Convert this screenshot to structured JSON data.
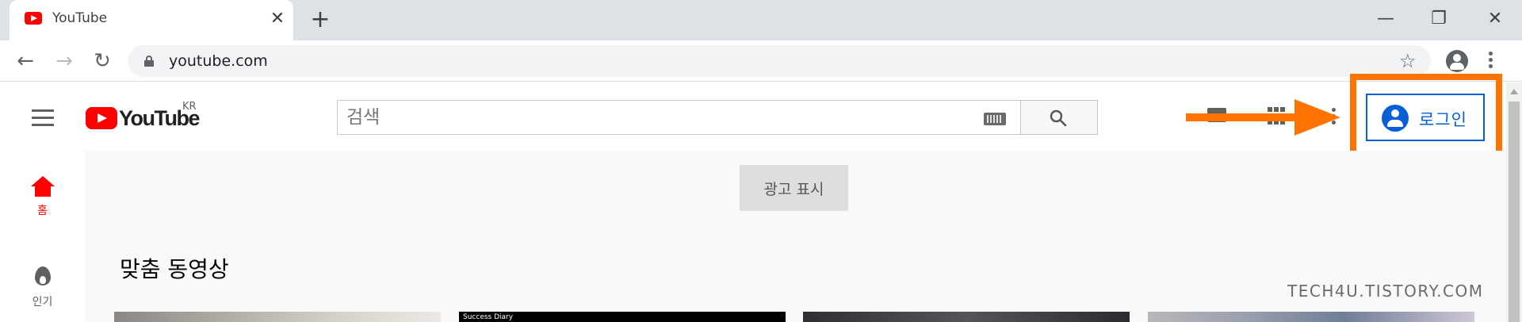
{
  "browser": {
    "tab_title": "YouTube",
    "tab_close": "✕",
    "new_tab": "+",
    "url": "youtube.com",
    "window_controls": {
      "minimize": "—",
      "maximize": "❐",
      "close": "✕"
    }
  },
  "header": {
    "logo_text": "YouTube",
    "logo_country": "KR",
    "search_placeholder": "검색",
    "login_label": "로그인"
  },
  "guide": {
    "items": [
      {
        "label": "홈",
        "icon": "home-icon",
        "active": true
      },
      {
        "label": "인기",
        "icon": "flame-icon",
        "active": false
      }
    ]
  },
  "main": {
    "ad_button": "광고 표시",
    "section_title": "맞춤 동영상",
    "thumbnails": [
      {
        "caption": ""
      },
      {
        "caption": "Success Diary"
      },
      {
        "caption": ""
      },
      {
        "caption": ""
      }
    ]
  },
  "watermark": "TECH4U.TISTORY.COM",
  "colors": {
    "youtube_red": "#ff0000",
    "link_blue": "#065fd4",
    "annotation_orange": "#ff7300"
  }
}
